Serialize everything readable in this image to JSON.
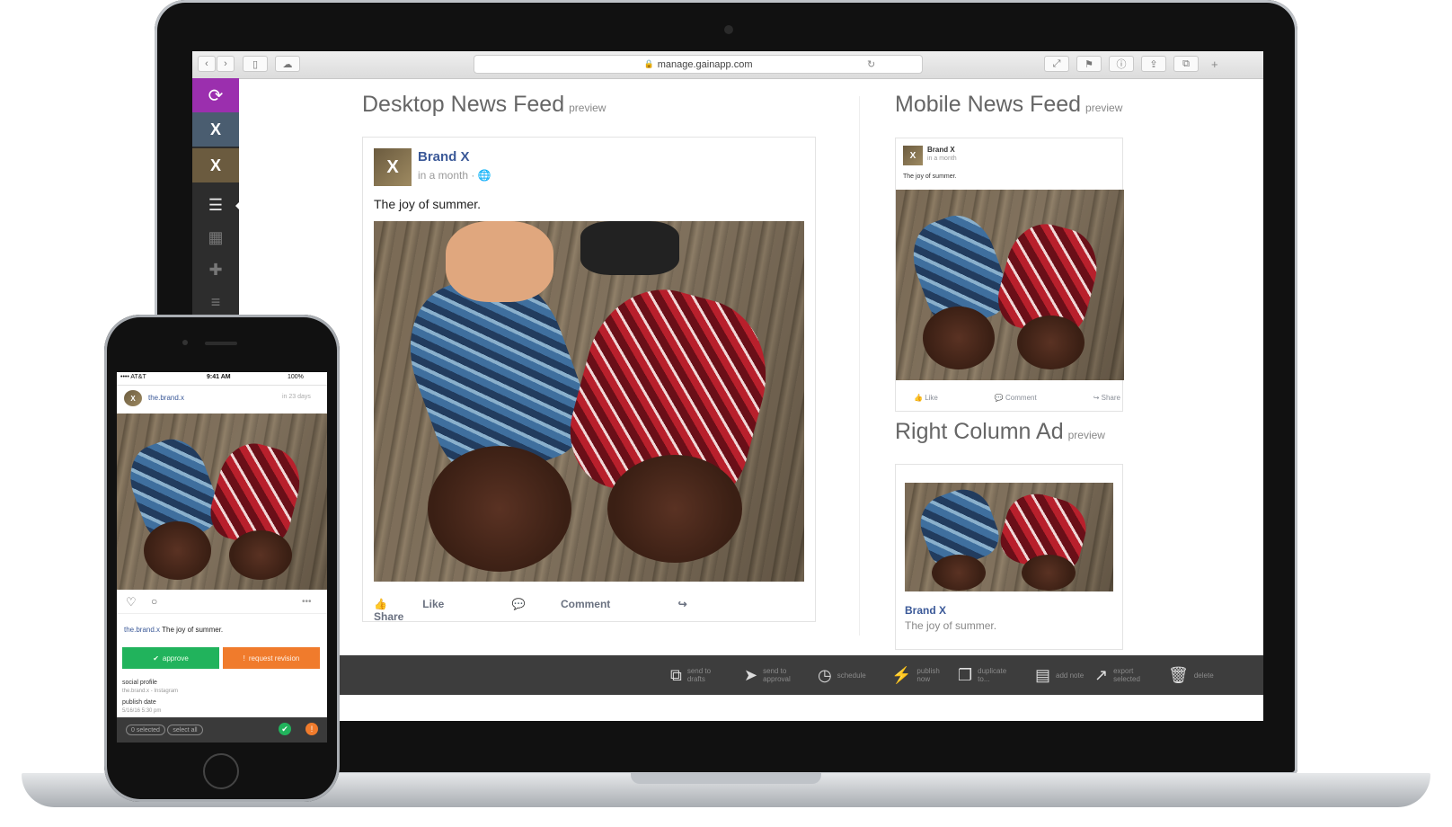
{
  "browser": {
    "url": "manage.gainapp.com",
    "back_icon": "chevron-left-icon",
    "forward_icon": "chevron-right-icon"
  },
  "sidebar": {
    "logo_icon": "gain-logo-icon",
    "agency_label": "X",
    "brand_label": "X",
    "items": [
      {
        "icon": "list-icon",
        "glyph": "☰"
      },
      {
        "icon": "calendar-icon",
        "glyph": "▦"
      },
      {
        "icon": "plus-icon",
        "glyph": "+"
      },
      {
        "icon": "sliders-icon",
        "glyph": "≡"
      }
    ]
  },
  "desktop_feed": {
    "heading": "Desktop News Feed",
    "sub": "preview",
    "brand": "Brand X",
    "time": "in a month",
    "text": "The joy of summer.",
    "like": "Like",
    "comment": "Comment",
    "share": "Share"
  },
  "mobile_feed": {
    "heading": "Mobile News Feed",
    "sub": "preview",
    "brand": "Brand X",
    "time": "in a month",
    "text": "The joy of summer.",
    "like": "Like",
    "comment": "Comment",
    "share": "Share"
  },
  "right_ad": {
    "heading": "Right Column Ad",
    "sub": "preview",
    "brand": "Brand X",
    "text": "The joy of summer."
  },
  "actions": [
    {
      "icon": "send-to-drafts-icon",
      "glyph": "⧉",
      "label": "send to drafts"
    },
    {
      "icon": "send-to-approval-icon",
      "glyph": "➤",
      "label": "send to approval"
    },
    {
      "icon": "schedule-icon",
      "glyph": "◷",
      "label": "schedule"
    },
    {
      "icon": "publish-now-icon",
      "glyph": "⚡",
      "label": "publish now"
    },
    {
      "icon": "duplicate-icon",
      "glyph": "❐",
      "label": "duplicate to..."
    },
    {
      "icon": "add-note-icon",
      "glyph": "▤",
      "label": "add note"
    },
    {
      "icon": "export-icon",
      "glyph": "↗",
      "label": "export selected"
    },
    {
      "icon": "delete-icon",
      "glyph": "🗑",
      "label": "delete"
    }
  ],
  "phone": {
    "carrier": "•••• AT&T",
    "time": "9:41 AM",
    "battery": "100%",
    "username": "the.brand.x",
    "post_time": "in 23 days",
    "caption_user": "the.brand.x",
    "caption_text": "The joy of summer.",
    "approve": "approve",
    "request_revision": "request revision",
    "social_profile_label": "social profile",
    "social_profile_value": "the.brand.x - Instagram",
    "publish_date_label": "publish date",
    "publish_date_value": "5/16/16 5:30 pm",
    "selected": "0 selected",
    "select_all": "select all"
  },
  "colors": {
    "brand_purple": "#9b2fae",
    "facebook_blue": "#3b5998",
    "approve_green": "#21b35c",
    "revision_orange": "#f07b2c"
  }
}
